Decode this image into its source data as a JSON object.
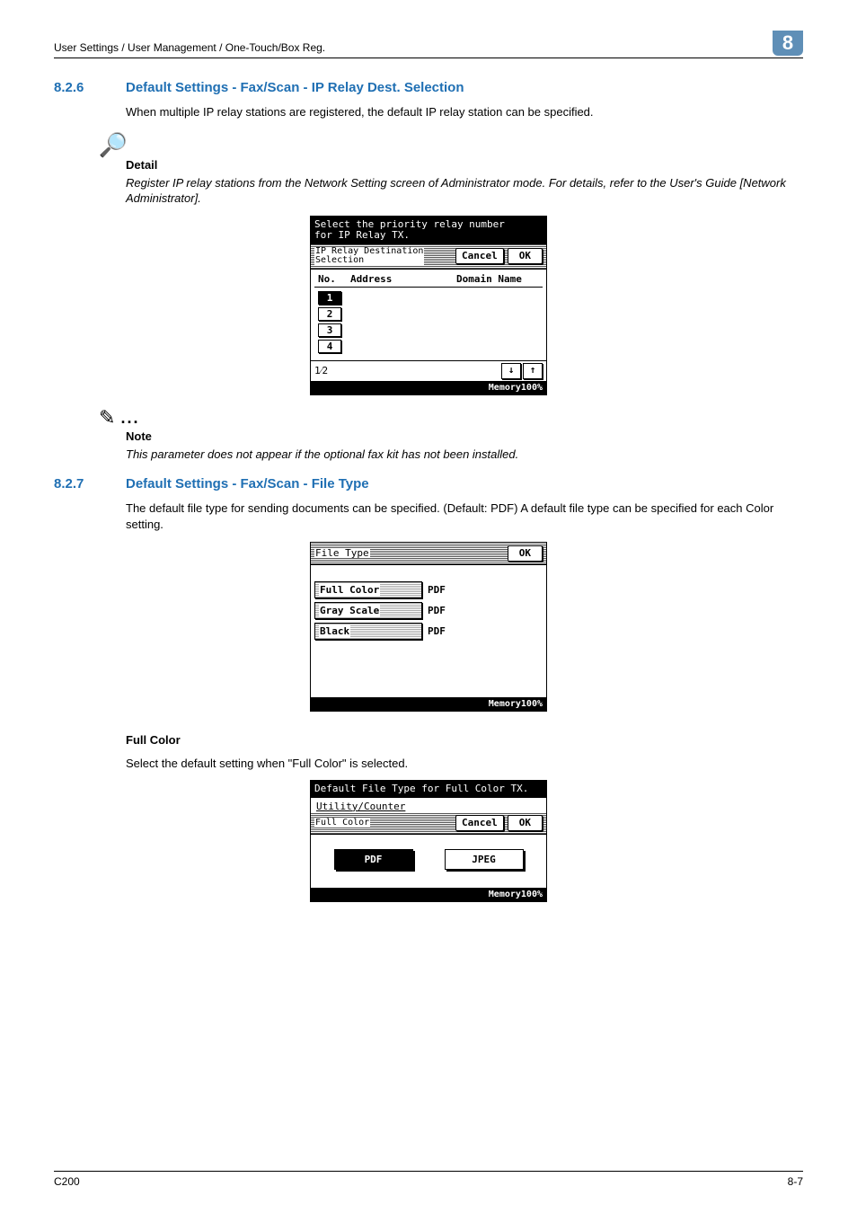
{
  "header": {
    "breadcrumb": "User Settings / User Management / One-Touch/Box Reg.",
    "chapter_num": "8"
  },
  "sec826": {
    "num": "8.2.6",
    "title": "Default Settings - Fax/Scan - IP Relay Dest. Selection",
    "intro": "When multiple IP relay stations are registered, the default IP relay station can be specified.",
    "detail_label": "Detail",
    "detail_text": "Register IP relay stations from the Network Setting screen of Administrator mode. For details, refer to the User's Guide [Network Administrator].",
    "panel": {
      "title": "Select the priority relay number\nfor IP Relay TX.",
      "sub_label": "IP Relay Destination\nSelection",
      "cancel": "Cancel",
      "ok": "OK",
      "col1": "No.",
      "col2": "Address",
      "col3": "Domain Name",
      "rows": [
        "1",
        "2",
        "3",
        "4"
      ],
      "page": "1⁄2",
      "memory": "Memory100%"
    },
    "note_label": "Note",
    "note_text": "This parameter does not appear if the optional fax kit has not been installed."
  },
  "sec827": {
    "num": "8.2.7",
    "title": "Default Settings - Fax/Scan - File Type",
    "intro": "The default file type for sending documents can be specified. (Default: PDF) A default file type can be specified for each Color setting.",
    "panel": {
      "title": "File Type",
      "ok": "OK",
      "rows": [
        {
          "label": "Full Color",
          "val": "PDF"
        },
        {
          "label": "Gray Scale",
          "val": "PDF"
        },
        {
          "label": "Black",
          "val": "PDF"
        }
      ],
      "memory": "Memory100%"
    },
    "fullcolor_heading": "Full Color",
    "fullcolor_intro": "Select the default setting when \"Full Color\" is selected.",
    "fc_panel": {
      "title": "Default File Type for Full Color TX.",
      "crumb": "Utility/Counter",
      "sub_label": "Full Color",
      "cancel": "Cancel",
      "ok": "OK",
      "opt_pdf": "PDF",
      "opt_jpeg": "JPEG",
      "memory": "Memory100%"
    }
  },
  "footer": {
    "left": "C200",
    "right": "8-7"
  }
}
